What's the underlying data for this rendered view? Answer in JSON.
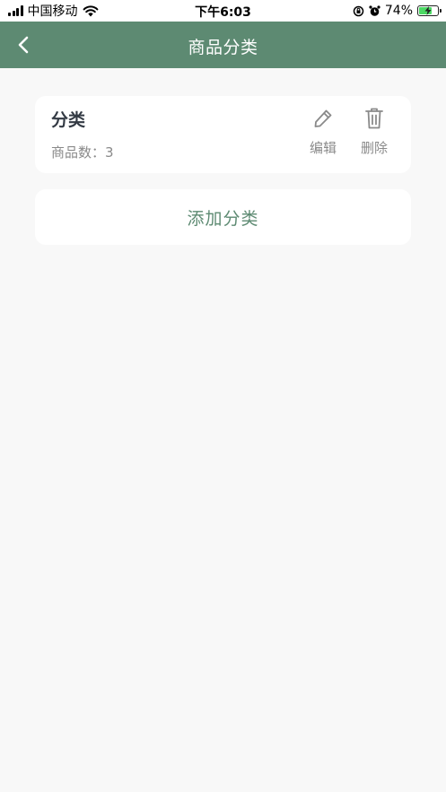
{
  "status_bar": {
    "carrier": "中国移动",
    "time": "下午6:03",
    "battery_percent": "74%",
    "battery_level": 0.74
  },
  "nav": {
    "title": "商品分类"
  },
  "categories": [
    {
      "name": "分类",
      "count_label": "商品数：3",
      "edit_label": "编辑",
      "delete_label": "删除"
    }
  ],
  "add_category": {
    "label": "添加分类"
  },
  "colors": {
    "accent": "#5d8a72",
    "background": "#f8f8f8",
    "card": "#ffffff",
    "muted_text": "#8a8a8a",
    "title_text": "#333a44"
  },
  "icons": {
    "back": "chevron-left-icon",
    "edit": "pencil-icon",
    "delete": "trash-icon"
  }
}
